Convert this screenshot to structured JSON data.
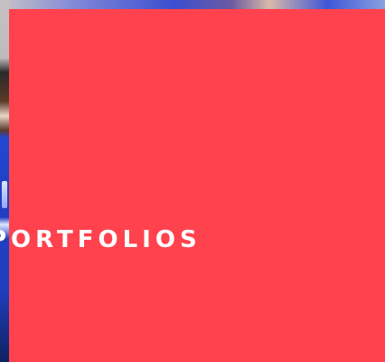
{
  "hero": {
    "title": "PORTFOLIOS",
    "overlay_color": "#ff424e"
  }
}
